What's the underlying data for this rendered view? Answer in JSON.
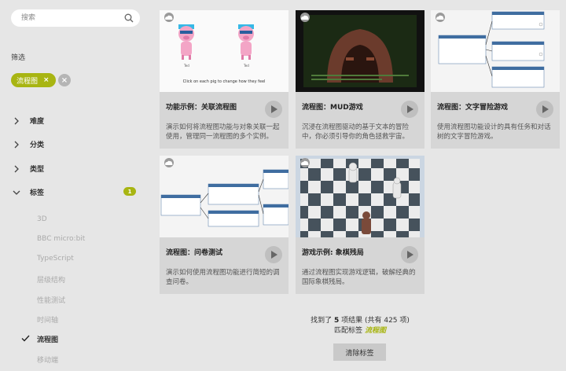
{
  "sidebar": {
    "search_placeholder": "搜索",
    "filter_label": "筛选",
    "chip_label": "流程图",
    "chip_x": "×",
    "clear_x": "×",
    "categories": [
      {
        "label": "难度"
      },
      {
        "label": "分类"
      },
      {
        "label": "类型"
      },
      {
        "label": "标签",
        "badge": "1"
      }
    ],
    "tags": [
      "3D",
      "BBC micro:bit",
      "TypeScript",
      "层级结构",
      "性能测试",
      "时间轴",
      "流程图",
      "移动端"
    ]
  },
  "cards": [
    {
      "title": "功能示例：关联流程图",
      "desc": "演示如何将流程图功能与对象关联一起使用，管理同一流程图的多个实例。",
      "thumb_caption": "Click on each pig to change how they feel",
      "thumb_labels": [
        "Ted",
        "Ted"
      ]
    },
    {
      "title": "流程图：MUD游戏",
      "desc": "沉浸在流程图驱动的基于文本的冒险中，你必须引导你的角色拯救宇宙。"
    },
    {
      "title": "流程图：文字冒险游戏",
      "desc": "使用流程图功能设计的具有任务和对话树的文字冒险游戏。"
    },
    {
      "title": "流程图：问卷测试",
      "desc": "演示如何使用流程图功能进行简短的调查问卷。"
    },
    {
      "title": "游戏示例: 象棋残局",
      "desc": "通过流程图实现游戏逻辑，破解经典的国际象棋残局。"
    }
  ],
  "results": {
    "line1_pre": "找到了",
    "count": "5",
    "line1_mid": "项结果 (共有",
    "total": "425",
    "line1_post": "项)",
    "line2_pre": "匹配标签",
    "tag": "流程图",
    "clear_label": "清除标签"
  },
  "colors": {
    "accent": "#a8b512",
    "background": "#e6e6e6",
    "card": "#d6d6d6"
  }
}
